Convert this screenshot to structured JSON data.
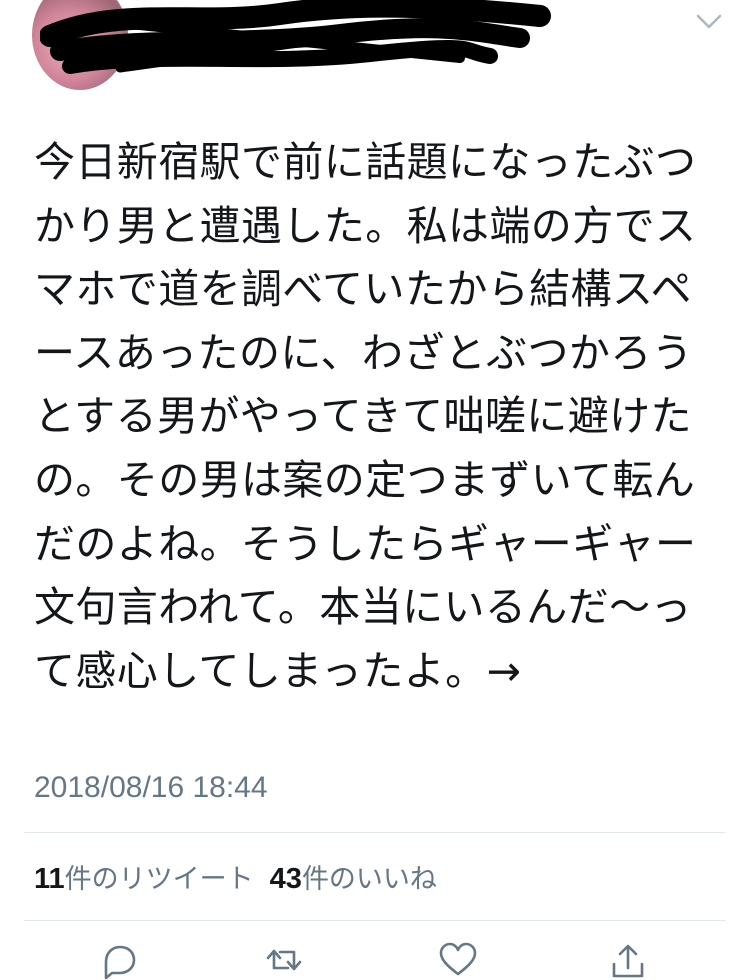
{
  "tweet": {
    "text": "今日新宿駅で前に話題になったぶつかり男と遭遇した。私は端の方でスマホで道を調べていたから結構スペースあったのに、わざとぶつかろうとする男がやってきて咄嗟に避けたの。その男は案の定つまずいて転んだのよね。そうしたらギャーギャー文句言われて。本当にいるんだ〜って感心してしまったよ。→",
    "timestamp": "2018/08/16 18:44"
  },
  "stats": {
    "retweets_count": "11",
    "retweets_label": "件のリツイート",
    "likes_count": "43",
    "likes_label": "件のいいね"
  },
  "icons": {
    "more": "chevron-down-icon",
    "reply": "reply-icon",
    "retweet": "retweet-icon",
    "like": "heart-icon",
    "share": "share-icon"
  },
  "colors": {
    "text": "#14171a",
    "secondary": "#657786",
    "divider": "#e1e8ed",
    "icon": "#657786"
  }
}
